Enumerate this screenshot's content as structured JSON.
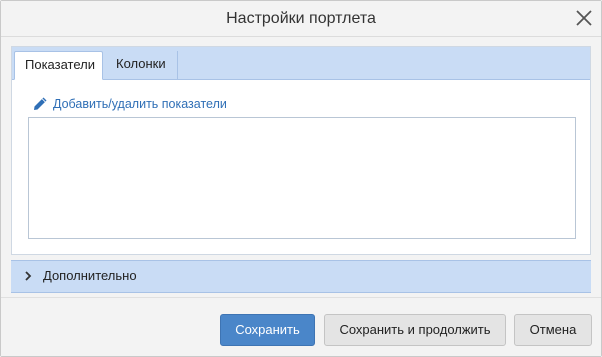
{
  "dialog": {
    "title": "Настройки портлета",
    "close_icon": "close-icon"
  },
  "tabs": [
    {
      "label": "Показатели",
      "active": true
    },
    {
      "label": "Колонки",
      "active": false
    }
  ],
  "indicators": {
    "edit_link": "Добавить/удалить показатели",
    "edit_icon": "pencil-icon",
    "items": []
  },
  "advanced": {
    "label": "Дополнительно",
    "expanded": false
  },
  "footer": {
    "save_label": "Сохранить",
    "save_continue_label": "Сохранить и продолжить",
    "cancel_label": "Отмена"
  },
  "colors": {
    "accent": "#4a86c9",
    "tab_bar": "#c9dcf5",
    "link": "#2f6fb6"
  }
}
